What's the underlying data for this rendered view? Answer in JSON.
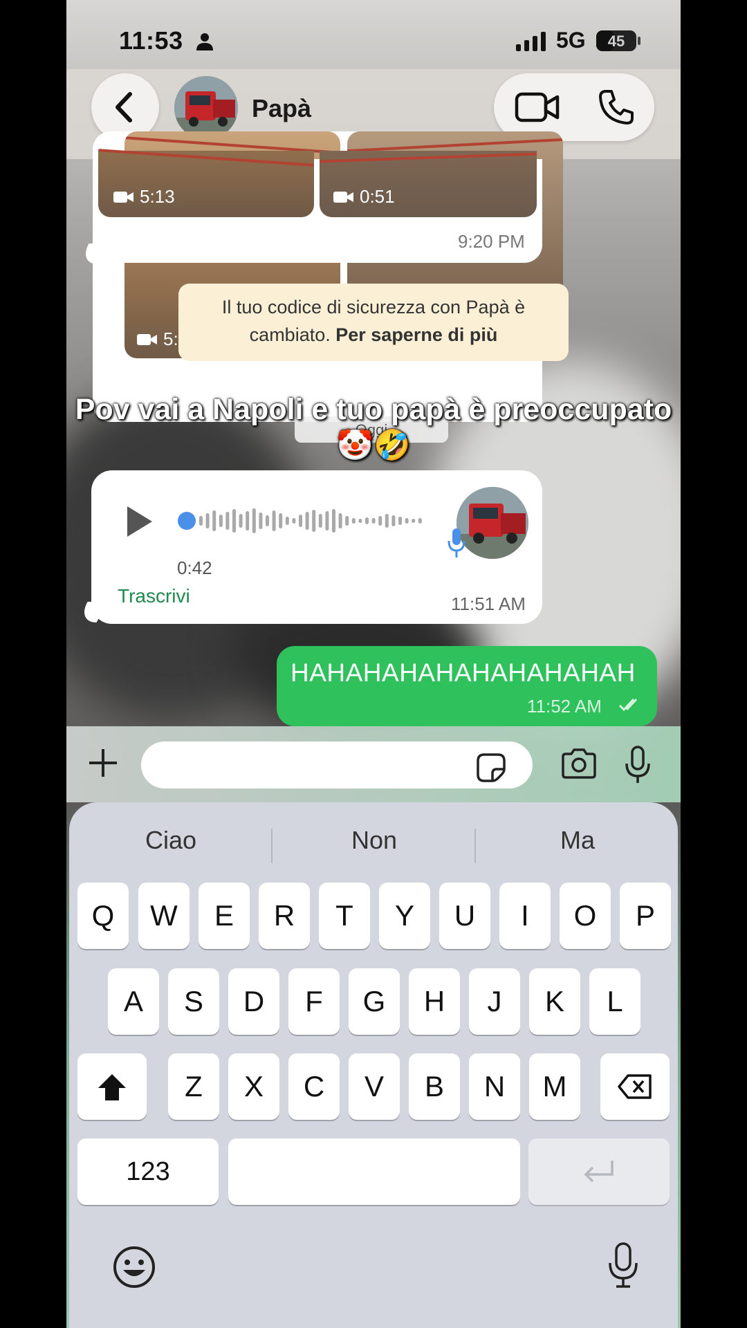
{
  "status": {
    "time": "11:53",
    "network": "5G",
    "battery": "45",
    "battery_level": 0.45
  },
  "header": {
    "contact_name": "Papà"
  },
  "chat": {
    "media": {
      "video1_duration": "5:13",
      "video2_duration": "0:51",
      "time": "9:20 PM"
    },
    "security_note": {
      "text": "Il tuo codice di sicurezza con Papà è cambiato.",
      "link": "Per saperne di più"
    },
    "overlay_caption": "Pov vai a Napoli e tuo papà è preoccupato 🤡🤣",
    "date_chip": "Oggi",
    "voice_message": {
      "duration": "0:42",
      "transcribe_label": "Trascrivi",
      "time": "11:51 AM"
    },
    "outgoing_message": {
      "text": "HAHAHAHAHAHAHAHAHAH",
      "time": "11:52 AM"
    }
  },
  "input": {
    "value": "",
    "placeholder": ""
  },
  "keyboard": {
    "suggestions": [
      "Ciao",
      "Non",
      "Ma"
    ],
    "row1": [
      "Q",
      "W",
      "E",
      "R",
      "T",
      "Y",
      "U",
      "I",
      "O",
      "P"
    ],
    "row2": [
      "A",
      "S",
      "D",
      "F",
      "G",
      "H",
      "J",
      "K",
      "L"
    ],
    "row3": [
      "Z",
      "X",
      "C",
      "V",
      "B",
      "N",
      "M"
    ],
    "numbers_label": "123"
  },
  "colors": {
    "outgoing": "#2fc15c",
    "accent_green": "#1f8a4c",
    "note_bg": "#fbf0d6",
    "keyboard_bg": "#d3d6de"
  },
  "icons": [
    "back-chevron-icon",
    "video-call-icon",
    "phone-call-icon",
    "play-icon",
    "mic-icon",
    "plus-icon",
    "sticker-icon",
    "camera-icon",
    "shift-icon",
    "backspace-icon",
    "emoji-icon",
    "dictation-icon",
    "return-icon"
  ]
}
